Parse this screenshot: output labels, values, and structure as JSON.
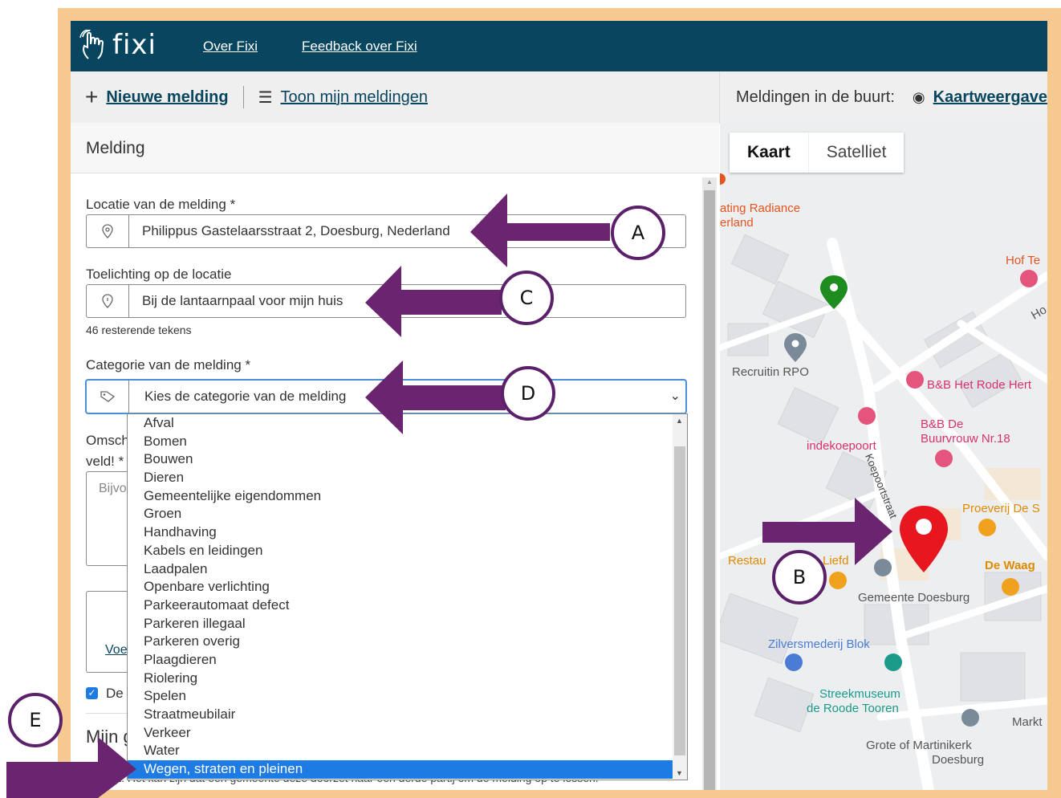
{
  "header": {
    "logo": "fixi",
    "links": [
      "Over Fixi",
      "Feedback over Fixi"
    ]
  },
  "subbar": {
    "new_report": "Nieuwe melding",
    "show_reports": "Toon mijn meldingen",
    "nearby_label": "Meldingen in de buurt:",
    "map_view": "Kaartweergave"
  },
  "form": {
    "title": "Melding",
    "location_label": "Locatie van de melding *",
    "location_value": "Philippus Gastelaarsstraat 2, Doesburg, Nederland",
    "explanation_label": "Toelichting op de locatie",
    "explanation_value": "Bij de lantaarnpaal voor mijn huis",
    "chars_remaining": "46 resterende tekens",
    "category_label": "Categorie van de melding *",
    "category_placeholder": "Kies de categorie van de melding",
    "description_label_1": "Omschr",
    "description_label_2": "veld! *",
    "description_placeholder": "Bijvo",
    "add_link": "Voe",
    "checkbox_label": "De",
    "section_partial": "Mijn g",
    "footer_partial": "e Tekst. Het kan zijn dat een gemeente deze doorzet naar een derde partij om de melding op te lossen."
  },
  "categories": {
    "options": [
      "Afval",
      "Bomen",
      "Bouwen",
      "Dieren",
      "Gemeentelijke eigendommen",
      "Groen",
      "Handhaving",
      "Kabels en leidingen",
      "Laadpalen",
      "Openbare verlichting",
      "Parkeerautomaat defect",
      "Parkeren illegaal",
      "Parkeren overig",
      "Plaagdieren",
      "Riolering",
      "Spelen",
      "Straatmeubilair",
      "Verkeer",
      "Water",
      "Wegen, straten en pleinen"
    ],
    "selected": "Wegen, straten en pleinen"
  },
  "map": {
    "tabs": [
      "Kaart",
      "Satelliet"
    ],
    "labels": {
      "radiance": "ating Radiance",
      "radiance2": "erland",
      "hof": "Hof Te",
      "ho": "Ho",
      "recruitin": "Recruitin RPO",
      "bb_rode_hert": "B&B Het Rode Hert",
      "bb_de": "B&B De",
      "buurvrouw": "Buurvrouw Nr.18",
      "indekoepoort": "indekoepoort",
      "koepoortstraat": "Koepoortstraat",
      "proeverij": "Proeverij De S",
      "restau": "Restau",
      "liefd": "Liefd",
      "de_waag": "De Waag",
      "gemeente": "Gemeente Doesburg",
      "zilversmederij": "Zilversmederij Blok",
      "streekmuseum": "Streekmuseum",
      "roode_tooren": "de Roode Tooren",
      "markt": "Markt",
      "grote_kerk": "Grote of Martinikerk",
      "doesburg": "Doesburg"
    }
  },
  "annotations": [
    "A",
    "B",
    "C",
    "D",
    "E"
  ],
  "colors": {
    "header_bg": "#08455f",
    "frame": "#f5c990",
    "arrow": "#6b2570",
    "selected_option": "#1e7be3",
    "marker_red": "#e8161e",
    "marker_green": "#1f8c1f"
  }
}
